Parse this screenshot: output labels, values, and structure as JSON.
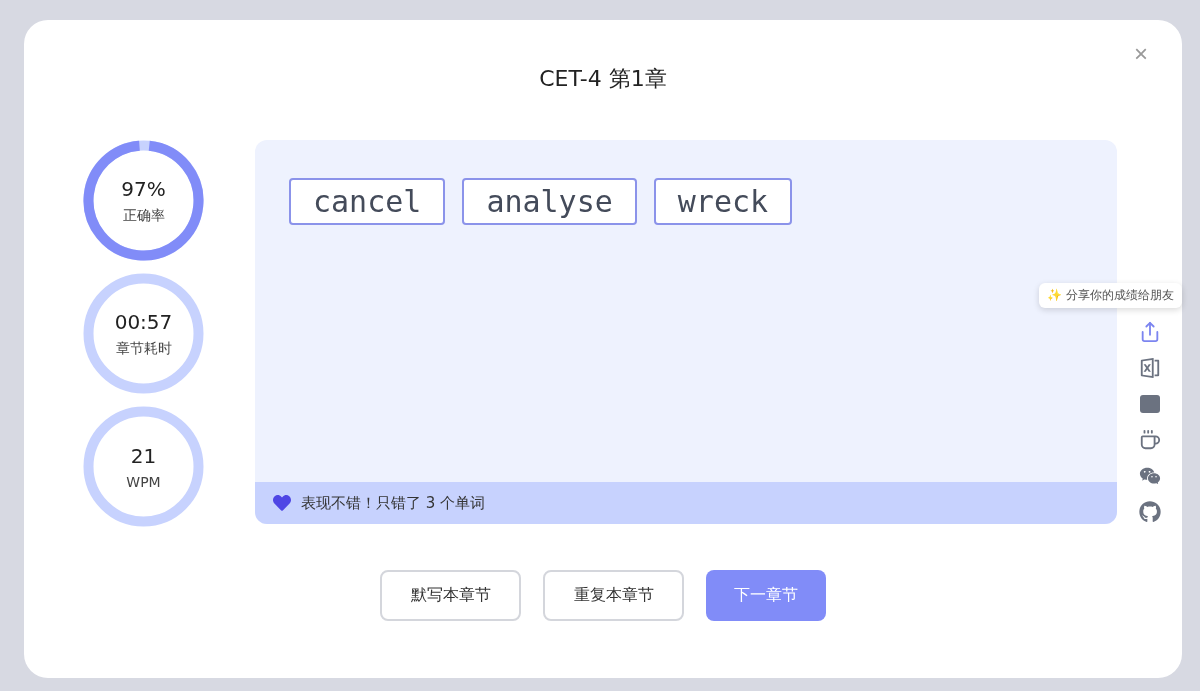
{
  "dialog": {
    "title": "CET-4 第1章",
    "close": "×"
  },
  "stats": [
    {
      "value": "97%",
      "label": "正确率",
      "kind": "progress"
    },
    {
      "value": "00:57",
      "label": "章节耗时",
      "kind": "plain"
    },
    {
      "value": "21",
      "label": "WPM",
      "kind": "plain"
    }
  ],
  "mistake_words": [
    "cancel",
    "analyse",
    "wreck"
  ],
  "feedback": "表现不错！只错了 3 个单词",
  "share_tip": "✨ 分享你的成绩给朋友",
  "side_icons": [
    {
      "kind": "share",
      "active": true
    },
    {
      "kind": "excel",
      "active": false
    },
    {
      "kind": "xiaohongshu",
      "active": false
    },
    {
      "kind": "coffee",
      "active": false
    },
    {
      "kind": "wechat",
      "active": false
    },
    {
      "kind": "github",
      "active": false
    }
  ],
  "buttons": [
    {
      "label": "默写本章节",
      "primary": false
    },
    {
      "label": "重复本章节",
      "primary": false
    },
    {
      "label": "下一章节",
      "primary": true
    }
  ]
}
